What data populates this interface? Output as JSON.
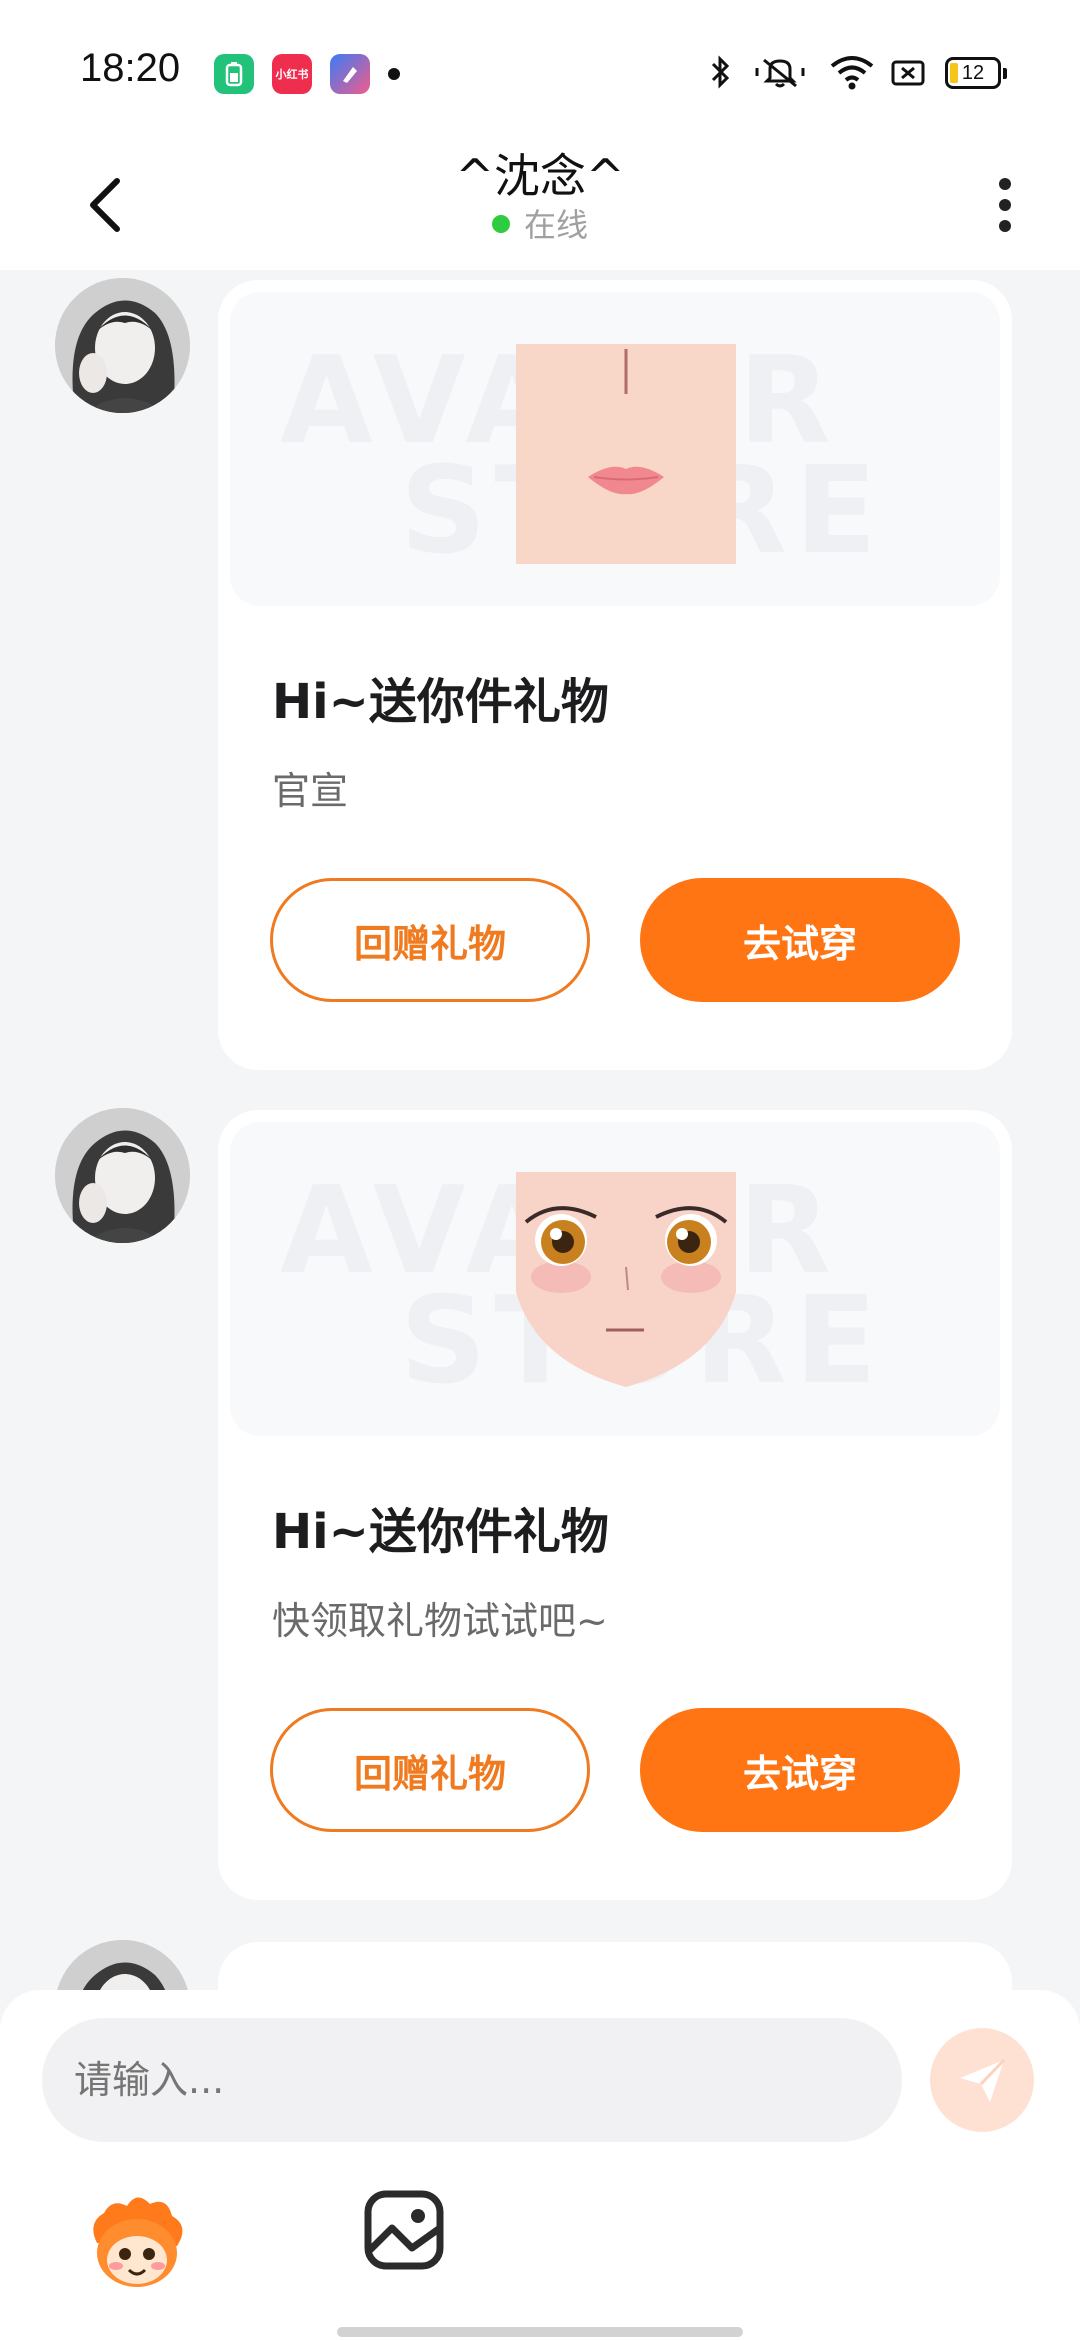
{
  "status_bar": {
    "time": "18:20",
    "app_icons": [
      {
        "name": "battery-app-icon",
        "color": "#22c27a"
      },
      {
        "name": "xiaohongshu-icon",
        "color": "#ef2d4f",
        "label": "小红书"
      },
      {
        "name": "shortcut-app-icon",
        "color": "#5b7cf5"
      }
    ],
    "battery_level": "12"
  },
  "header": {
    "title": "^沈念^",
    "status": "在线",
    "status_color": "#2ecc40"
  },
  "messages": [
    {
      "type": "gift-card",
      "title": "Hi~送你件礼物",
      "subtitle": "官宣",
      "image": "lips-face-skin",
      "watermark": "AVATAR STORE",
      "secondary_button": "回赠礼物",
      "primary_button": "去试穿"
    },
    {
      "type": "gift-card",
      "title": "Hi~送你件礼物",
      "subtitle": "快领取礼物试试吧~",
      "image": "anime-eyes-face-skin",
      "watermark": "AVATAR STORE",
      "secondary_button": "回赠礼物",
      "primary_button": "去试穿"
    }
  ],
  "input": {
    "placeholder": "请输入..."
  },
  "colors": {
    "accent": "#ff7413",
    "background": "#f4f5f7"
  }
}
